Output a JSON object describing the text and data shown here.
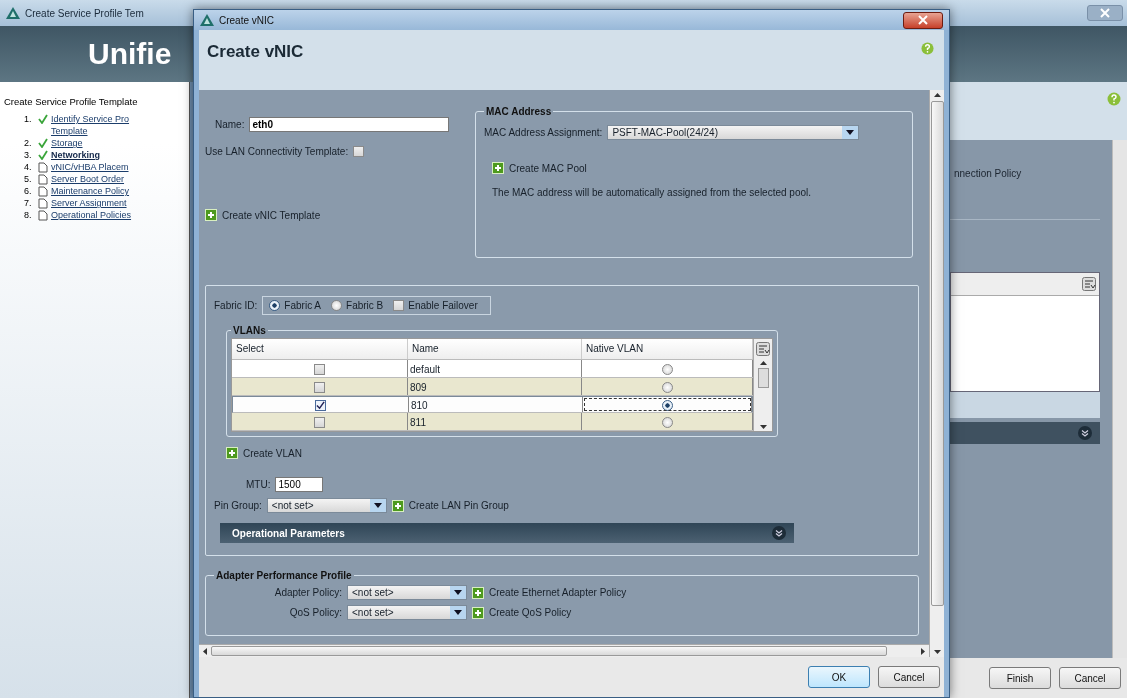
{
  "background_window": {
    "title": "Create Service Profile Tem",
    "header": "Unifie",
    "wizard_title": "Create Service Profile Template",
    "steps": [
      {
        "number": "1.",
        "lines": [
          "Identify Service Pro",
          "Template"
        ],
        "kind": "done",
        "selected": false
      },
      {
        "number": "2.",
        "lines": [
          "Storage"
        ],
        "kind": "done",
        "selected": false
      },
      {
        "number": "3.",
        "lines": [
          "Networking"
        ],
        "kind": "done",
        "selected": true
      },
      {
        "number": "4.",
        "lines": [
          "vNIC/vHBA Placem"
        ],
        "kind": "pending",
        "selected": false
      },
      {
        "number": "5.",
        "lines": [
          "Server Boot Order"
        ],
        "kind": "pending",
        "selected": false
      },
      {
        "number": "6.",
        "lines": [
          "Maintenance Policy"
        ],
        "kind": "pending",
        "selected": false
      },
      {
        "number": "7.",
        "lines": [
          "Server Assignment"
        ],
        "kind": "pending",
        "selected": false
      },
      {
        "number": "8.",
        "lines": [
          "Operational Policies"
        ],
        "kind": "pending",
        "selected": false
      }
    ],
    "partial_text": "nnection Policy",
    "buttons": [
      "Finish",
      "Cancel"
    ]
  },
  "dialog": {
    "title": "Create vNIC",
    "heading": "Create vNIC",
    "name_label": "Name:",
    "name_value": "eth0",
    "lan_template_label": "Use LAN Connectivity Template:",
    "lan_template_checked": false,
    "create_vnic_template": "Create vNIC Template",
    "mac": {
      "legend": "MAC Address",
      "assignment_label": "MAC Address Assignment:",
      "assignment_value": "PSFT-MAC-Pool(24/24)",
      "create_link": "Create MAC Pool",
      "note": "The MAC address will be automatically assigned from the selected pool."
    },
    "fabric": {
      "label": "Fabric ID:",
      "options": [
        {
          "label": "Fabric A",
          "selected": true
        },
        {
          "label": "Fabric B",
          "selected": false
        }
      ],
      "failover_label": "Enable Failover",
      "failover_checked": false
    },
    "vlans": {
      "legend": "VLANs",
      "columns": [
        "Select",
        "Name",
        "Native VLAN"
      ],
      "rows": [
        {
          "checked": false,
          "name": "default",
          "native": false,
          "selected": false
        },
        {
          "checked": false,
          "name": "809",
          "native": false,
          "selected": false
        },
        {
          "checked": true,
          "name": "810",
          "native": true,
          "selected": true
        },
        {
          "checked": false,
          "name": "811",
          "native": false,
          "selected": false
        }
      ]
    },
    "create_vlan": "Create VLAN",
    "mtu_label": "MTU:",
    "mtu_value": "1500",
    "pin_group_label": "Pin Group:",
    "pin_group_value": "<not set>",
    "create_pin_group": "Create LAN Pin Group",
    "operational_parameters": "Operational Parameters",
    "adapter": {
      "legend": "Adapter Performance Profile",
      "rows": [
        {
          "label": "Adapter Policy:",
          "value": "<not set>",
          "create_link": "Create Ethernet Adapter Policy"
        },
        {
          "label": "QoS Policy:",
          "value": "<not set>",
          "create_link": "Create QoS Policy"
        }
      ]
    },
    "buttons": [
      "OK",
      "Cancel"
    ]
  }
}
